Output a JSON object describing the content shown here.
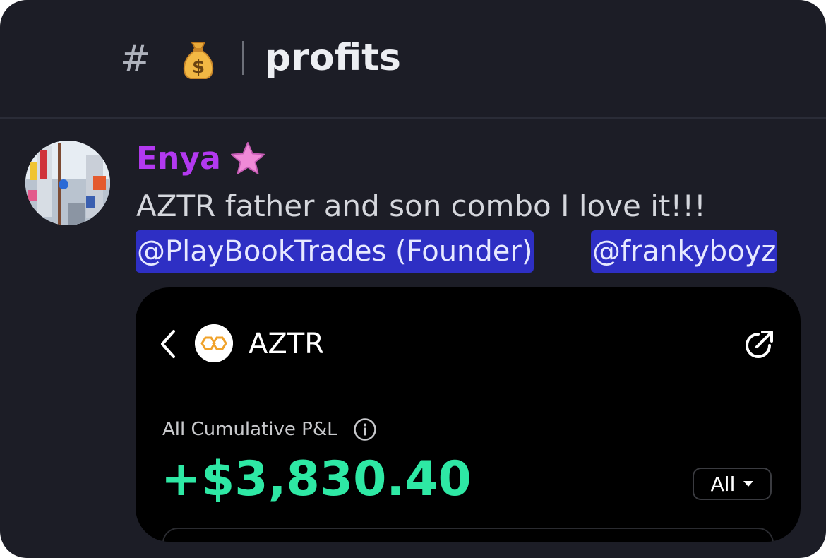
{
  "channel": {
    "hash_symbol": "#",
    "icon": "money-bag-icon",
    "name": "profits"
  },
  "message": {
    "author": "Enya",
    "author_color": "#b339f0",
    "author_badge_icon": "star-icon",
    "avatar_icon": "city-street-avatar",
    "text": "AZTR father and son combo I love it!!!",
    "mentions": [
      "@PlayBookTrades (Founder)",
      "@frankyboyz"
    ]
  },
  "embed": {
    "back_icon": "chevron-left-icon",
    "token_logo_icon": "token-logo-icon",
    "ticker": "AZTR",
    "share_icon": "share-icon",
    "pnl_label": "All Cumulative P&L",
    "info_icon": "info-icon",
    "pnl_value": "+$3,830.40",
    "pnl_color": "#2ee8a4",
    "range_selected": "All"
  }
}
